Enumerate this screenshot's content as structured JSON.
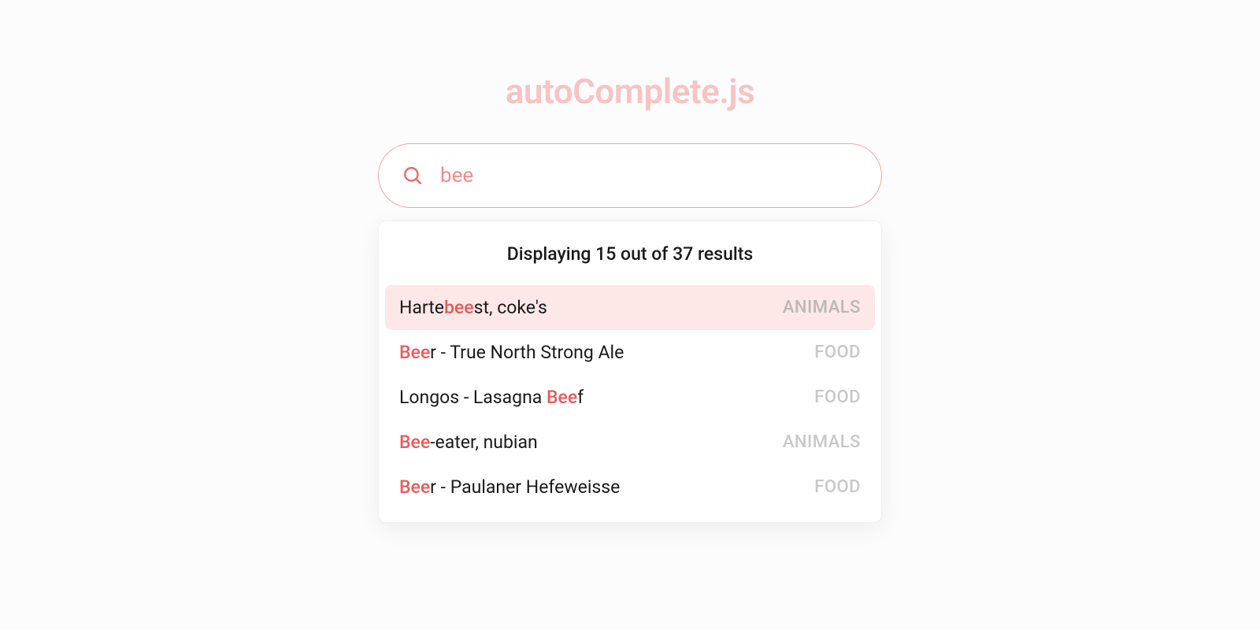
{
  "title": "autoComplete.js",
  "search": {
    "query": "bee",
    "placeholder": ""
  },
  "results": {
    "count_text": "Displaying 15 out of 37 results",
    "displayed": 15,
    "total": 37,
    "items": [
      {
        "pre": "Harte",
        "match": "bee",
        "post": "st, coke's",
        "category": "ANIMALS",
        "highlighted": true
      },
      {
        "pre": "",
        "match": "Bee",
        "post": "r - True North Strong Ale",
        "category": "FOOD",
        "highlighted": false
      },
      {
        "pre": "Longos - Lasagna ",
        "match": "Bee",
        "post": "f",
        "category": "FOOD",
        "highlighted": false
      },
      {
        "pre": "",
        "match": "Bee",
        "post": "-eater, nubian",
        "category": "ANIMALS",
        "highlighted": false
      },
      {
        "pre": "",
        "match": "Bee",
        "post": "r - Paulaner Hefeweisse",
        "category": "FOOD",
        "highlighted": false
      }
    ]
  },
  "colors": {
    "accent": "#f28b8b",
    "accent_light": "#f8c3c3",
    "border": "#f5a3a3",
    "highlight_bg": "#fde7e7",
    "match_text": "#ec5a5a"
  }
}
